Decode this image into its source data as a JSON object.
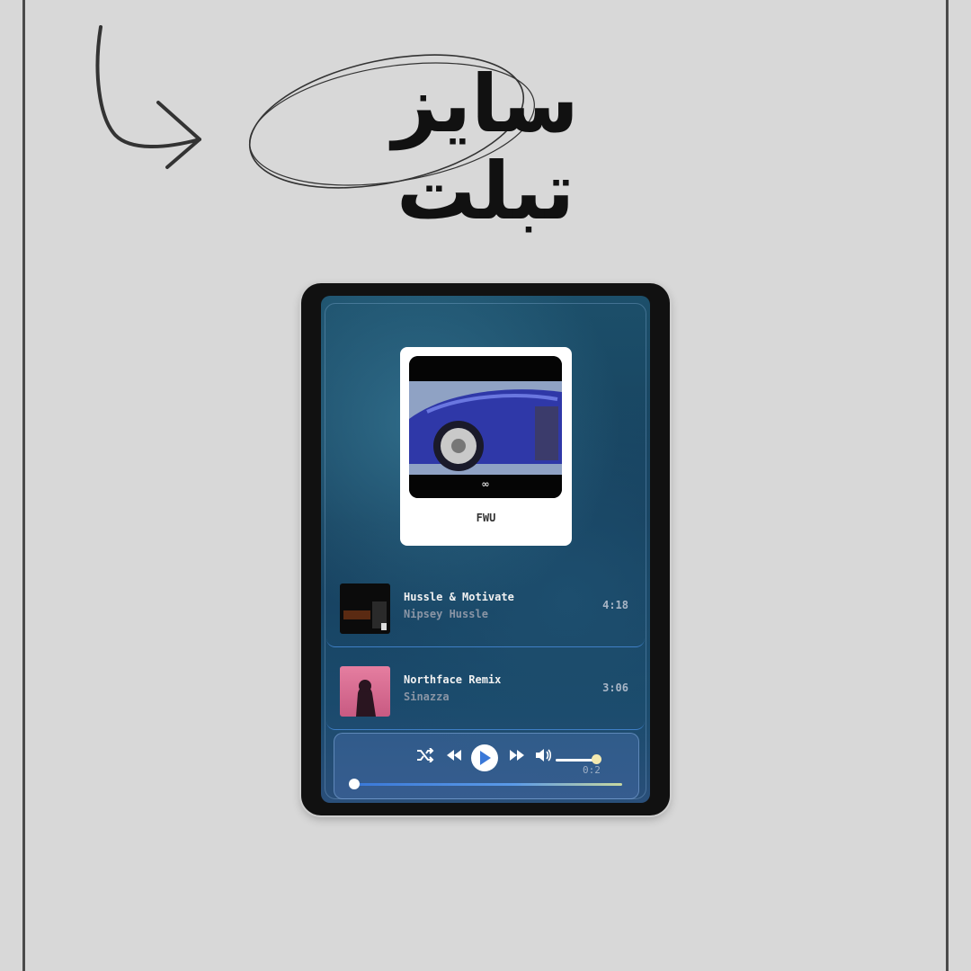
{
  "heading": "سايز تبلت",
  "album": {
    "title": "FWU"
  },
  "tracks": [
    {
      "title": "Hussle & Motivate",
      "artist": "Nipsey Hussle",
      "duration": "4:18"
    },
    {
      "title": "Northface Remix",
      "artist": "Sinazza",
      "duration": "3:06"
    }
  ],
  "player": {
    "time": "0:2",
    "progress": 0.02,
    "volume": 1.0
  },
  "icons": {
    "arrow": "curved-arrow-icon",
    "shuffle": "shuffle-icon",
    "prev": "previous-icon",
    "play": "play-icon",
    "next": "next-icon",
    "volume": "volume-icon"
  },
  "colors": {
    "page_background": "#d8d8d8",
    "accent": "#3f7fc6",
    "play_icon": "#3a78d8"
  }
}
